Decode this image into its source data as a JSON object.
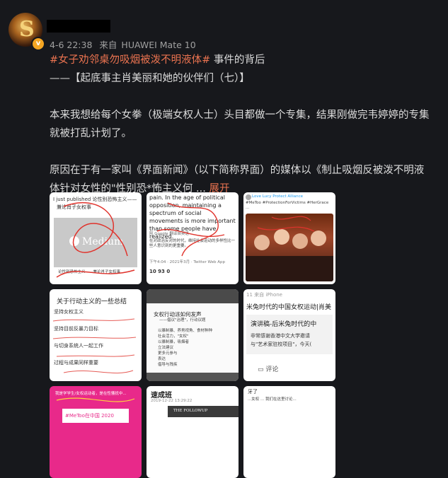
{
  "post": {
    "author_name": "",
    "meta": {
      "date": "4-6 22:38",
      "source_prefix": "来自",
      "device": "HUAWEI Mate 10"
    },
    "topic": "#女子劝邻桌勿吸烟被泼不明液体#",
    "title_suffix": " 事件的背后",
    "series_title": "——【起底事主肖美丽和她的伙伴们（七）】",
    "para1": "本来我想给每个女拳（极端女权人士）头目都做一个专集，结果刚做完韦婷婷的专集就被打乱计划了。",
    "para2": "原因在于有一家叫《界面新闻》（以下简称界面）的媒体以《制止吸烟反被泼不明液体针对女性的\"性别恐*怖主义何",
    "ellipsis": " ... ",
    "expand_label": "展开"
  },
  "images": {
    "t1": {
      "line1": "I just published 论性别恐怖主义——",
      "line2": "兼论肖子女权事",
      "brand": "Medium",
      "caption": "论性别恐怖主义——兼论肖子女权事"
    },
    "t2": {
      "text": "pain. In the age of political opposition, maintaining a spectrum of social movements is more important than some people have realized.",
      "stats": "10  93  0",
      "footer": "下午4:04 · 2021年3月 · Twitter Web App"
    },
    "t3": {
      "header": "Love Lucy Protect Alliance"
    },
    "t4": {
      "title": "关于行动主义的一些总结",
      "bullets": [
        "坚持女权主义",
        "坚持目前反暴力目标",
        "与切身系统人一起工作",
        "过程与成果同样重要"
      ]
    },
    "t5": {
      "title": "女权行动派如何发声",
      "subtitle": "——倡议\"治理\"，行动议题",
      "items": [
        "以暴制暴、养男视角、食材种种",
        "社会活力，\"女权\"",
        "以暴制暴，吸烟者",
        "立法建议",
        "更多元参与",
        "表达",
        "倡导与残疾"
      ]
    },
    "t6": {
      "source": "11  来自 iPhone",
      "headline": "米兔时代的中国女权运动|肖美",
      "box_title": "演讲稿-后米兔时代的中",
      "box_line2": "非常感谢香港中文大学邀请",
      "box_line3": "与\"艺术家驻校项目\"，今天(",
      "comment": "评论"
    },
    "t7": {
      "tag": "#MeToo在中国 2020"
    },
    "t8": {
      "brand": "速成班",
      "date": "2019-12-22 13:29:22",
      "banner": "THE FOLLOWUP"
    },
    "t9": {
      "header": "牙了"
    }
  },
  "colors": {
    "accent": "#eb7350",
    "background": "#17181c",
    "text": "#dcdcdc"
  }
}
